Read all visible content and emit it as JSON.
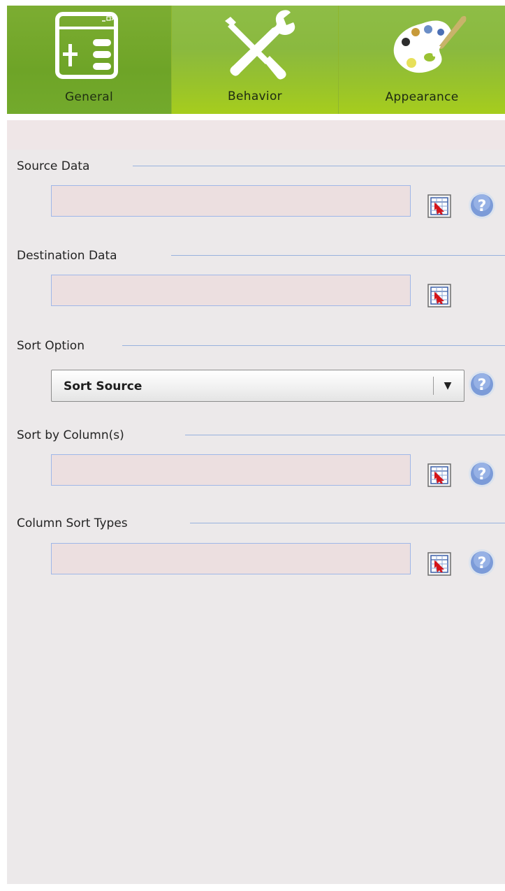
{
  "tabs": [
    {
      "label": "General",
      "icon": "window-layout-icon",
      "selected": true
    },
    {
      "label": "Behavior",
      "icon": "tools-icon",
      "selected": false
    },
    {
      "label": "Appearance",
      "icon": "palette-icon",
      "selected": false
    }
  ],
  "sections": {
    "source_data": {
      "label": "Source Data",
      "value": ""
    },
    "destination_data": {
      "label": "Destination Data",
      "value": ""
    },
    "sort_option": {
      "label": "Sort Option",
      "selected": "Sort Source"
    },
    "sort_by_columns": {
      "label": "Sort by Column(s)",
      "value": ""
    },
    "column_sort_types": {
      "label": "Column Sort Types",
      "value": ""
    }
  },
  "colors": {
    "tab_active": "#6ea427",
    "tab_inactive": "#97c22d",
    "panel_bg": "#ece9ea",
    "field_bg": "#ecdfe0",
    "field_border": "#9fb7e8",
    "rule": "#98b2dd"
  }
}
